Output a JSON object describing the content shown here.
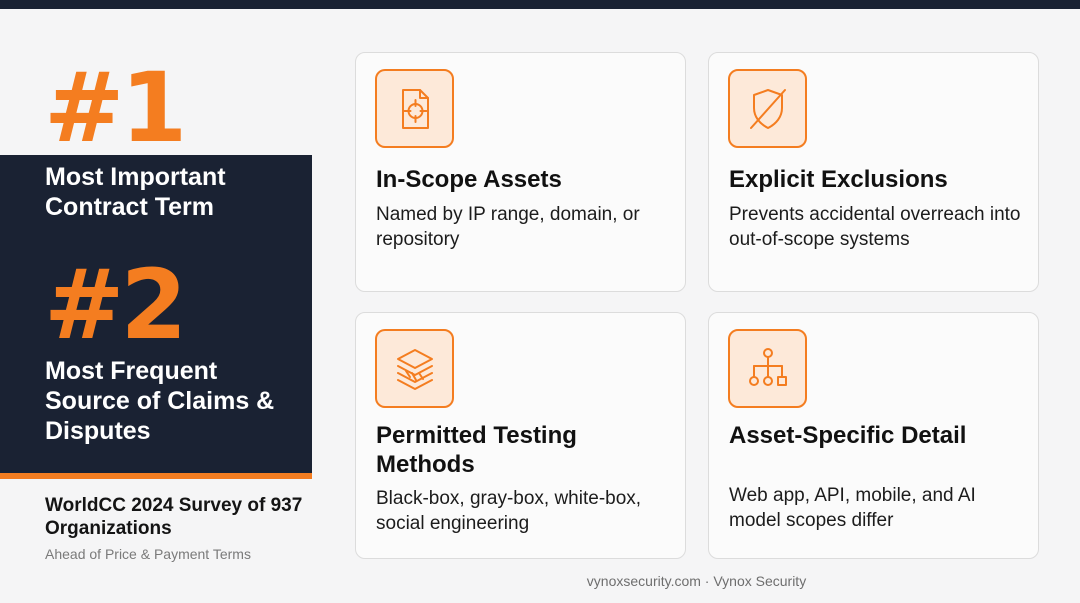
{
  "stats": {
    "first_rank": "#1",
    "first_label": "Most Important Contract Term",
    "second_rank": "#2",
    "second_label": "Most Frequent Source of Claims & Disputes",
    "source": "WorldCC 2024 Survey of 937 Organizations",
    "sub_source": "Ahead of Price & Payment Terms"
  },
  "cards": [
    {
      "title": "In-Scope Assets",
      "body": "Named by IP range, domain, or repository",
      "icon": "document-target-icon"
    },
    {
      "title": "Explicit Exclusions",
      "body": "Prevents accidental overreach into out-of-scope systems",
      "icon": "shield-off-icon"
    },
    {
      "title": "Permitted Testing Methods",
      "body": "Black-box, gray-box, white-box, social engineering",
      "icon": "layers-icon"
    },
    {
      "title": "Asset-Specific Detail",
      "body": "Web app, API, mobile, and AI model scopes differ",
      "icon": "hierarchy-icon"
    }
  ],
  "footer": "vynoxsecurity.com · Vynox Security",
  "colors": {
    "accent": "#f47d20",
    "dark": "#1a2233",
    "background": "#f5f5f6"
  }
}
